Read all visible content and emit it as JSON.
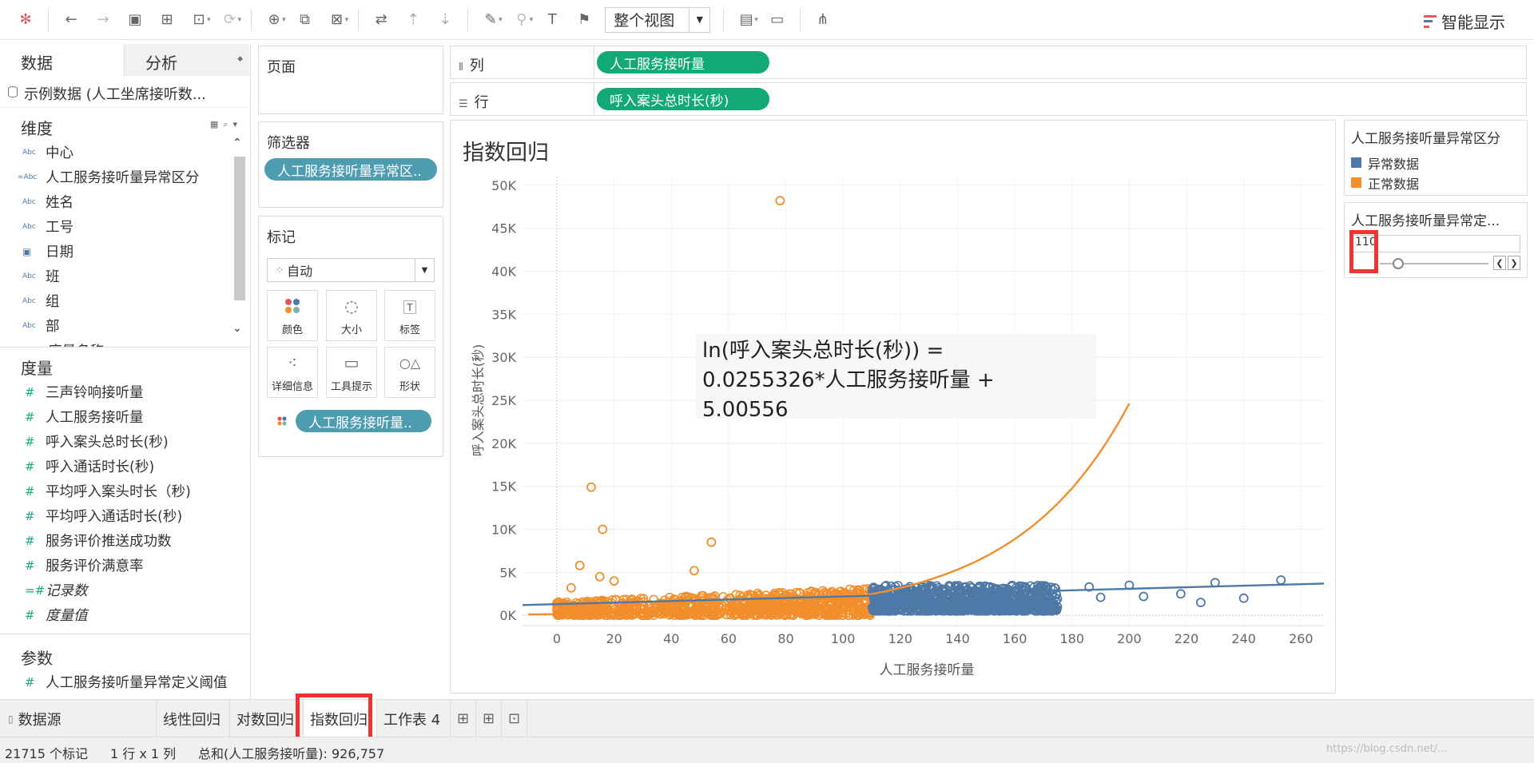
{
  "toolbar": {
    "view_mode": "整个视图",
    "show_me": "智能显示"
  },
  "left_pane": {
    "tabs": [
      "数据",
      "分析"
    ],
    "datasource": "示例数据 (人工坐席接听数...",
    "dimensions_header": "维度",
    "dimensions": [
      {
        "type": "Abc",
        "name": "中心"
      },
      {
        "type": "=Abc",
        "name": "人工服务接听量异常区分"
      },
      {
        "type": "Abc",
        "name": "姓名"
      },
      {
        "type": "Abc",
        "name": "工号"
      },
      {
        "type": "date",
        "name": "日期"
      },
      {
        "type": "Abc",
        "name": "班"
      },
      {
        "type": "Abc",
        "name": "组"
      },
      {
        "type": "Abc",
        "name": "部"
      },
      {
        "type": "Abc",
        "name": "度量名称"
      }
    ],
    "measures_header": "度量",
    "measures": [
      "三声铃响接听量",
      "人工服务接听量",
      "呼入案头总时长(秒)",
      "呼入通话时长(秒)",
      "平均呼入案头时长（秒)",
      "平均呼入通话时长(秒)",
      "服务评价推送成功数",
      "服务评价满意率",
      "记录数",
      "度量值"
    ],
    "parameters_header": "参数",
    "parameters": [
      "人工服务接听量异常定义阈值"
    ]
  },
  "pages_card": {
    "title": "页面"
  },
  "filters_card": {
    "title": "筛选器",
    "pill": "人工服务接听量异常区.."
  },
  "marks_card": {
    "title": "标记",
    "mark_type": "自动",
    "buttons": [
      "颜色",
      "大小",
      "标签",
      "详细信息",
      "工具提示",
      "形状"
    ],
    "pill": "人工服务接听量.."
  },
  "shelves": {
    "columns_label": "列",
    "columns_pill": "人工服务接听量",
    "rows_label": "行",
    "rows_pill": "呼入案头总时长(秒)"
  },
  "chart": {
    "title": "指数回归",
    "annotation": [
      "ln(呼入案头总时长(秒)) =",
      "0.0255326*人工服务接听量 +",
      "5.00556"
    ],
    "colors": {
      "abnormal": "#4e79a7",
      "normal": "#f28e2b"
    }
  },
  "chart_data": {
    "type": "scatter",
    "title": "指数回归",
    "xlabel": "人工服务接听量",
    "ylabel": "呼入案头总时长(秒)",
    "xlim": [
      -12,
      268
    ],
    "ylim": [
      -1000,
      51000
    ],
    "x_ticks": [
      0,
      20,
      40,
      60,
      80,
      100,
      120,
      140,
      160,
      180,
      200,
      220,
      240,
      260
    ],
    "y_ticks": [
      0,
      5000,
      10000,
      15000,
      20000,
      25000,
      30000,
      35000,
      40000,
      45000,
      50000
    ],
    "y_tick_labels": [
      "0K",
      "5K",
      "10K",
      "15K",
      "20K",
      "25K",
      "30K",
      "35K",
      "40K",
      "45K",
      "50K"
    ],
    "series": [
      {
        "name": "正常数据",
        "color": "#f28e2b",
        "outliers": [
          [
            78,
            48200
          ],
          [
            12,
            14900
          ],
          [
            16,
            10000
          ],
          [
            54,
            8500
          ],
          [
            8,
            5800
          ],
          [
            15,
            4500
          ],
          [
            48,
            5200
          ],
          [
            5,
            3200
          ],
          [
            20,
            4000
          ]
        ],
        "band": {
          "x": [
            0,
            110
          ],
          "y": [
            0,
            3000
          ]
        }
      },
      {
        "name": "异常数据",
        "color": "#4e79a7",
        "outliers": [
          [
            253,
            4100
          ],
          [
            230,
            3800
          ],
          [
            200,
            3500
          ],
          [
            186,
            3300
          ],
          [
            205,
            2200
          ],
          [
            225,
            1500
          ],
          [
            240,
            2000
          ],
          [
            218,
            2500
          ],
          [
            190,
            2100
          ]
        ],
        "band": {
          "x": [
            110,
            175
          ],
          "y": [
            500,
            4500
          ]
        }
      }
    ],
    "trend_lines": [
      {
        "name": "exponential",
        "color": "#f28e2b",
        "a": 5.00556,
        "b": 0.0255326
      },
      {
        "name": "linear",
        "color": "#4e79a7",
        "points": [
          [
            -12,
            1200
          ],
          [
            268,
            3700
          ]
        ]
      }
    ]
  },
  "legend": {
    "title": "人工服务接听量异常区分",
    "items": [
      {
        "label": "异常数据",
        "color": "#4e79a7"
      },
      {
        "label": "正常数据",
        "color": "#f28e2b"
      }
    ]
  },
  "parameter_control": {
    "title": "人工服务接听量异常定...",
    "value": "110"
  },
  "sheet_tabs": {
    "datasource": "数据源",
    "sheets": [
      "线性回归",
      "对数回归",
      "指数回归",
      "工作表 4"
    ],
    "active": "指数回归"
  },
  "status": {
    "marks": "21715 个标记",
    "grid": "1 行 x 1 列",
    "sum": "总和(人工服务接听量): 926,757",
    "watermark": "https://blog.csdn.net/..."
  }
}
